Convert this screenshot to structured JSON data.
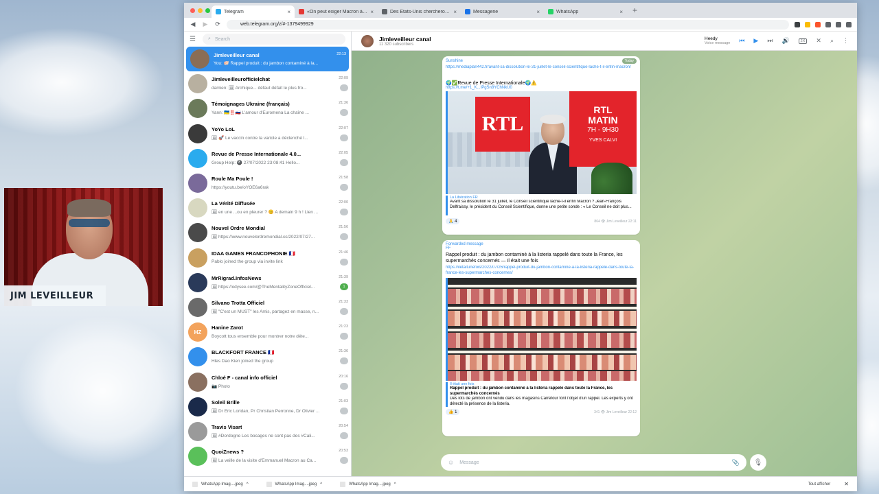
{
  "webcam": {
    "name_label": "JIM LEVEILLEUR"
  },
  "browser": {
    "tabs": [
      {
        "title": "Telegram",
        "color": "#2aabee",
        "active": true
      },
      {
        "title": "«On peut exiger Macron à dégag...",
        "color": "#e53935",
        "active": false
      },
      {
        "title": "Des Etats-Unis chercheront des...",
        "color": "#5f6368",
        "active": false
      },
      {
        "title": "Messagerie",
        "color": "#1a73e8",
        "active": false
      },
      {
        "title": "WhatsApp",
        "color": "#25d366",
        "active": false
      }
    ],
    "url": "web.telegram.org/z/#-1379499929"
  },
  "telegram": {
    "search_placeholder": "Search",
    "chats": [
      {
        "name": "Jimleveilleur canal",
        "preview": "You: 🐖 Rappel produit : du jambon contaminé à la...",
        "time": "22:13",
        "badge": "",
        "active": true,
        "avatar_color": "#8a6d55"
      },
      {
        "name": "Jimleveilleurofficielchat",
        "preview": "damien: 🖼 Archique... défaut défait le plus fro...",
        "time": "22:09",
        "badge": "",
        "active": false,
        "avatar_color": "#b8b0a0"
      },
      {
        "name": "Témoignages Ukraine (français)",
        "preview": "Yann: 🇺🇦‼️🇷🇺 L'amour d'Euromena La chaîne ...",
        "time": "21:36",
        "badge": "",
        "active": false,
        "avatar_color": "#6b7a5a"
      },
      {
        "name": "YoYo LoL",
        "preview": "🖼 🚀 Le vaccin contre la variole a déclenché l...",
        "time": "22:07",
        "badge": "",
        "active": false,
        "avatar_color": "#3a3a3a"
      },
      {
        "name": "Revue de Presse Internationale 4.0...",
        "preview": "Group Help: 🎱 27/07/2022 23:08:41 Hello...",
        "time": "22:05",
        "badge": "",
        "active": false,
        "avatar_color": "#2aabee"
      },
      {
        "name": "Roule Ma Poule !",
        "preview": "https://youtu.be/oYOE6a6rak",
        "time": "21:58",
        "badge": "",
        "active": false,
        "avatar_color": "#7a6a9a"
      },
      {
        "name": "La Vérité Diffusée",
        "preview": "🖼 en une ...ou en pleurer ? 😊 A demain 9 h ! Lien ...",
        "time": "22:00",
        "badge": "",
        "active": false,
        "avatar_color": "#d8d8c0"
      },
      {
        "name": "Nouvel Ordre Mondial",
        "preview": "🖼 https://www.nouvelordremondial.cc/2022/07/27...",
        "time": "21:56",
        "badge": "",
        "active": false,
        "avatar_color": "#4a4a4a"
      },
      {
        "name": "IDAA GAMES FRANCOPHONIE 🇫🇷",
        "preview": "Pablo joined the group via invite link",
        "time": "21:46",
        "badge": "",
        "active": false,
        "avatar_color": "#c9a060"
      },
      {
        "name": "MrRigrad.InfosNews",
        "preview": "🖼 https://odysee.com/@TheMentalityZoneOfficiel...",
        "time": "21:39",
        "badge": "1",
        "active": false,
        "avatar_color": "#2a3a5a"
      },
      {
        "name": "Silvano Trotta Officiel",
        "preview": "🖼 \"C'est un MUST\" les Amis, partagez en masse, n...",
        "time": "21:33",
        "badge": "",
        "active": false,
        "avatar_color": "#6a6a6a"
      },
      {
        "name": "Hanine Zarot",
        "preview": "Boycott tous ensemble pour montrer notre déte...",
        "time": "21:23",
        "badge": "",
        "active": false,
        "avatar_color": "#f3a35c",
        "initials": "HZ"
      },
      {
        "name": "BLACKFORT FRANCE 🇫🇷",
        "preview": "Hles Dao Kien joined the group",
        "time": "21:36",
        "badge": "",
        "active": false,
        "avatar_color": "#3390ec"
      },
      {
        "name": "Chloé F - canal info officiel",
        "preview": "📷 Photo",
        "time": "20:16",
        "badge": "",
        "active": false,
        "avatar_color": "#8a7060"
      },
      {
        "name": "Soleil Brille",
        "preview": "🖼 Dr Eric Loridan, Pr Christian Perronne, Dr Olivier ...",
        "time": "21:03",
        "badge": "",
        "active": false,
        "avatar_color": "#1a2a4a"
      },
      {
        "name": "Travis Visart",
        "preview": "🖼 #Dordogne Les bocages ne sont pas des #Cali...",
        "time": "20:54",
        "badge": "",
        "active": false,
        "avatar_color": "#9a9a9a"
      },
      {
        "name": "QuoiZnews ?",
        "preview": "🖼 La veille de la visite d'Emmanuel Macron au Ca...",
        "time": "20:53",
        "badge": "",
        "active": false,
        "avatar_color": "#5ac05a"
      }
    ],
    "header": {
      "title": "Jimleveilleur canal",
      "subtitle": "11 320 subscribers",
      "player_name": "Heedy",
      "player_sub": "Voice message",
      "speed": "2X"
    },
    "messages": {
      "m1": {
        "top_label": "Sunshine",
        "link1": "https://mediaplan442.fr/avant-sa-dissolution-le-31-juillet-le-conseil-scientifique-lache-t-il-enfin-macron/",
        "title": "🌍✅Revue de Presse Internationale🌍⚠️",
        "link2": "https://t.me/+1_K...IPgSn8YChNkU0",
        "image_logo": "RTL",
        "image_side_l1": "RTL",
        "image_side_l2": "MATIN",
        "image_hours": "7H - 9H30",
        "image_host": "YVES CALVI",
        "caption_source": "La Libération FR",
        "caption": "Avant sa dissolution le 31 juillet, le Conseil scientifique lâche-t-il enfin Macron ? Jean-François Delfraissy, le président du Conseil Scientifique, donne une petite sonde : « Le Conseil ne doit plus...",
        "reaction": "🙏 4",
        "meta": "864 👁 Jim Leveilleur 22:11",
        "today": "Today"
      },
      "m2": {
        "forwarded": "Forwarded message",
        "from": "FF",
        "title": "Rappel produit : du jambon contaminé à la listeria rappelé dans toute la France, les supermarchés concernés — Il était une fois",
        "link": "https://ilétaitunefois/2022/07/26/rappel-produit-du-jambon-contamine-a-la-listeria-rappele-dans-toute-la-france-les-supermarches-concernes/",
        "caption_source": "Il était une fois",
        "caption_title": "Rappel produit : du jambon contaminé à la listeria rappelé dans toute la France, les supermarchés concernés",
        "caption": "Des lots de jambon ont vendu dans les magasins Carrefour font l'objet d'un rappel. Les experts y ont détecté la présence de la listeria.",
        "reaction": "👍 1",
        "meta": "341 👁 Jim Leveilleur 22:12"
      }
    },
    "composer_placeholder": "Message"
  },
  "downloads": {
    "items": [
      "WhatsApp Imag....jpeg",
      "WhatsApp Imag....jpeg",
      "WhatsApp Imag....jpeg"
    ],
    "show_all": "Tout afficher"
  }
}
